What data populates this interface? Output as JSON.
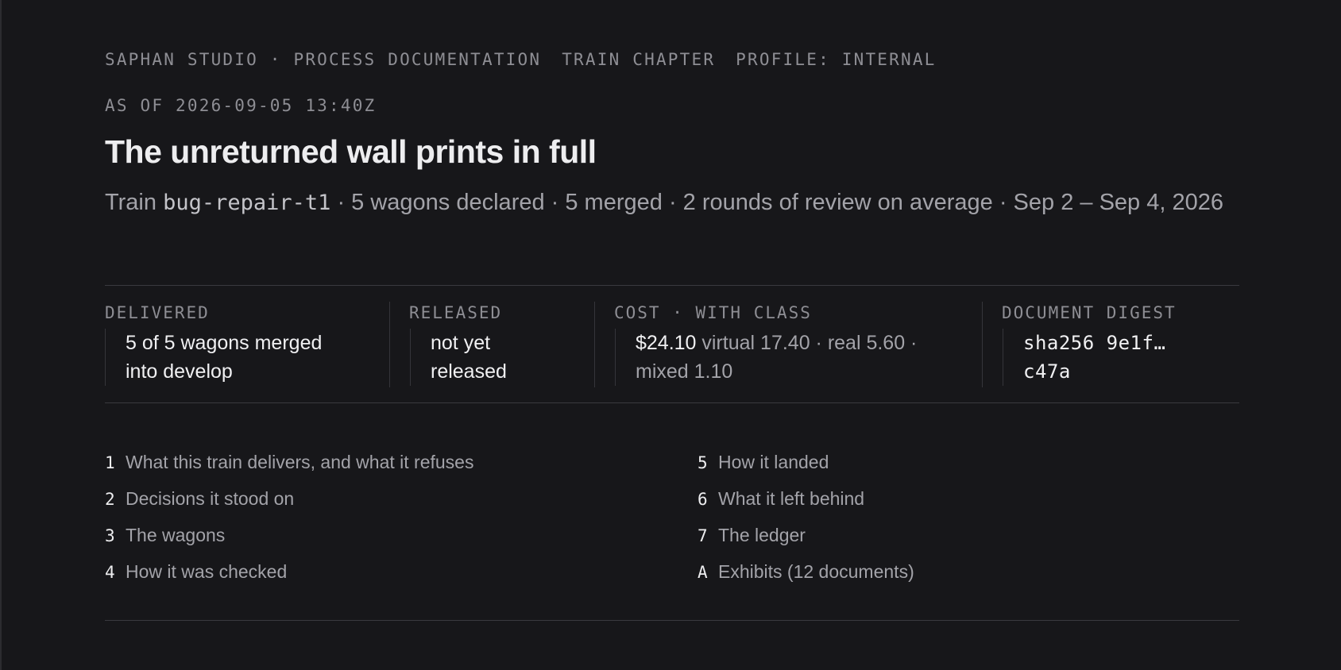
{
  "header": {
    "breadcrumb": {
      "org": "SAPHAN STUDIO · PROCESS DOCUMENTATION",
      "chapter": "TRAIN CHAPTER",
      "profile": "PROFILE: INTERNAL"
    },
    "as_of": "AS OF 2026-09-05 13:40Z",
    "title": "The unreturned wall prints in full",
    "subtitle": {
      "prefix": "Train ",
      "train_id": "bug-repair-t1",
      "suffix": " · 5 wagons declared · 5 merged · 2 rounds of review on average · Sep 2 – Sep 4, 2026"
    }
  },
  "stats": {
    "delivered": {
      "label": "DELIVERED",
      "value": "5 of 5 wagons merged into develop"
    },
    "released": {
      "label": "RELEASED",
      "value": "not yet released"
    },
    "cost": {
      "label": "COST · WITH CLASS",
      "total": "$24.10",
      "breakdown": " virtual 17.40 · real 5.60 · mixed 1.10"
    },
    "digest": {
      "label": "DOCUMENT DIGEST",
      "value": "sha256 9e1f… c47a"
    }
  },
  "toc": [
    {
      "num": "1",
      "label": "What this train delivers, and what it refuses"
    },
    {
      "num": "2",
      "label": "Decisions it stood on"
    },
    {
      "num": "3",
      "label": "The wagons"
    },
    {
      "num": "4",
      "label": "How it was checked"
    },
    {
      "num": "5",
      "label": "How it landed"
    },
    {
      "num": "6",
      "label": "What it left behind"
    },
    {
      "num": "7",
      "label": "The ledger"
    },
    {
      "num": "A",
      "label": "Exhibits (12 documents)"
    }
  ]
}
